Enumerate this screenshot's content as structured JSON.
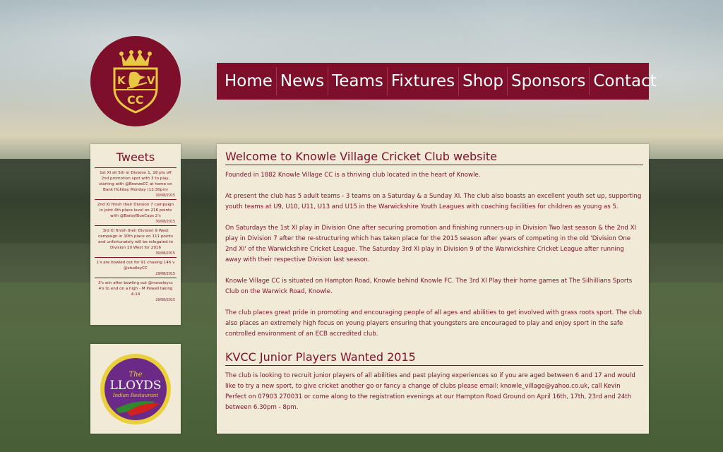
{
  "logo": {
    "letters_top_left": "K",
    "letters_top_right": "V",
    "letters_bottom": "CC",
    "color": "#7d0f2a",
    "accent": "#e8c744"
  },
  "nav": {
    "items": [
      "Home",
      "News",
      "Teams",
      "Fixtures",
      "Shop",
      "Sponsors",
      "Contact"
    ]
  },
  "tweets": {
    "title": "Tweets",
    "items": [
      {
        "text": "1st XI sit 5th in Division 1, 18 pts off 2nd promotion spot with 3 to play, starting with @BronzeCC at home on Bank Holiday Monday (12:30pm)",
        "date": "30/08/2015"
      },
      {
        "text": "2nd XI finish their Division 7 campaign in joint 4th place level on 216 points with @BarbyBlueCaps 2's",
        "date": "30/08/2015"
      },
      {
        "text": "3rd XI finish their Division 9 West campaign in 10th place on 111 points and unfortunately will be relegated to Division 10 West for 2016",
        "date": "30/08/2015"
      },
      {
        "text": "1's are bowled out for 91 chasing 146 v @studleyCC",
        "date": "29/08/2015"
      },
      {
        "text": "3's win after bowling out @moseleycc 4's to end on a high - M Powell taking 4-14",
        "date": "29/08/2015"
      }
    ]
  },
  "sponsor": {
    "the": "The",
    "name": "LLOYDS",
    "subtitle": "Indian Restaurant"
  },
  "main": {
    "welcome_title": "Welcome to Knowle Village Cricket Club website",
    "paragraphs": [
      "Founded in 1882 Knowle Village CC is a thriving club located in the heart of Knowle.",
      "At present the club has 5 adult teams - 3 teams on a Saturday & a Sunday XI. The club also boasts an excellent youth set up, supporting youth teams at U9, U10, U11, U13 and U15 in the Warwickshire Youth Leagues with coaching facilities for children as young as 5.",
      "On Saturdays the 1st XI play in Division One after securing promotion and finishing runners-up in Division Two last season & the 2nd XI play in Division 7 after the re-structuring which has taken place for the 2015 season after years of competing in the old 'Division One 2nd XI' of the Warwickshire Cricket League. The Saturday 3rd XI play in Division 9 of the Warwickshire Cricket League after running away with their respective Division last season.",
      "Knowle Village CC is situated on Hampton Road, Knowle behind Knowle FC. The 3rd XI Play their home games at The Silhillians Sports Club on the Warwick Road, Knowle.",
      "The club places great pride in promoting and encouraging people of all ages and abilities to get involved with grass roots sport. The club also places an extremely high focus on young players ensuring that youngsters are encouraged to play and enjoy sport in the safe controlled environment of an ECB accredited club."
    ],
    "junior_title": "KVCC Junior Players Wanted 2015",
    "junior_text": "The club is looking to recruit junior players of all abilities and past playing experiences so if you are aged between 6 and 17 and would like to try a new sport, to give cricket another go or fancy a change of clubs please email: knowle_village@yahoo.co.uk, call Kevin Perfect on 07903 270031 or come along to the registration evenings at our Hampton Road Ground on April 16th, 17th, 23rd and 24th between 6.30pm - 8pm."
  }
}
